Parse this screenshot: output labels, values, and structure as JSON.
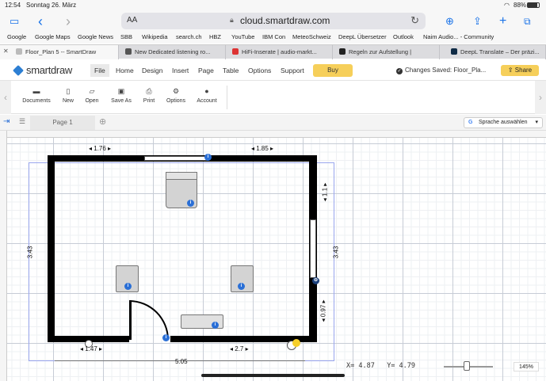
{
  "status_bar": {
    "time": "12:54",
    "date": "Sonntag 26. März",
    "wifi": "wifi",
    "battery": "88%"
  },
  "toolbar": {
    "url": "cloud.smartdraw.com",
    "aa": "AA"
  },
  "favorites": [
    "Google",
    "Google Maps",
    "Google News",
    "SBB",
    "Wikipedia",
    "search.ch",
    "HBZ",
    "YouTube",
    "IBM Con",
    "MeteoSchweiz",
    "DeepL Übersetzer",
    "Outlook",
    "Naim Audio... - Community"
  ],
  "tabs": [
    {
      "label": "Floor_Plan 5 -- SmartDraw",
      "active": true
    },
    {
      "label": "New Dedicated listening ro...",
      "active": false
    },
    {
      "label": "HiFi-Inserate | audio-markt...",
      "active": false
    },
    {
      "label": "Regeln zur Aufstellung |",
      "active": false
    },
    {
      "label": "DeepL Translate – Der präzi...",
      "active": false
    }
  ],
  "app": {
    "logo": "smartdraw",
    "menu": [
      "File",
      "Home",
      "Design",
      "Insert",
      "Page",
      "Table",
      "Options",
      "Support"
    ],
    "buy": "Buy",
    "saved": "Changes Saved: Floor_Pla...",
    "share": "Share"
  },
  "ribbon": [
    "Documents",
    "New",
    "Open",
    "Save As",
    "Print",
    "Options",
    "Account"
  ],
  "page_tab": "Page 1",
  "translate": "Sprache auswählen",
  "dimensions": {
    "top_left": "1.76",
    "top_right": "1.85",
    "left": "3.43",
    "right": "3.43",
    "right_upper": "1.1",
    "right_lower": "0.97",
    "bottom_left": "1.47",
    "bottom_right": "2.7",
    "bottom": "5.05"
  },
  "coords": {
    "x": "X= 4.87",
    "y": "Y= 4.79"
  },
  "zoom": {
    "value": "145%",
    "level": 0.45
  },
  "colors": {
    "accent": "#2a6fd6",
    "buy": "#f6cf5a",
    "wall": "#000000"
  }
}
